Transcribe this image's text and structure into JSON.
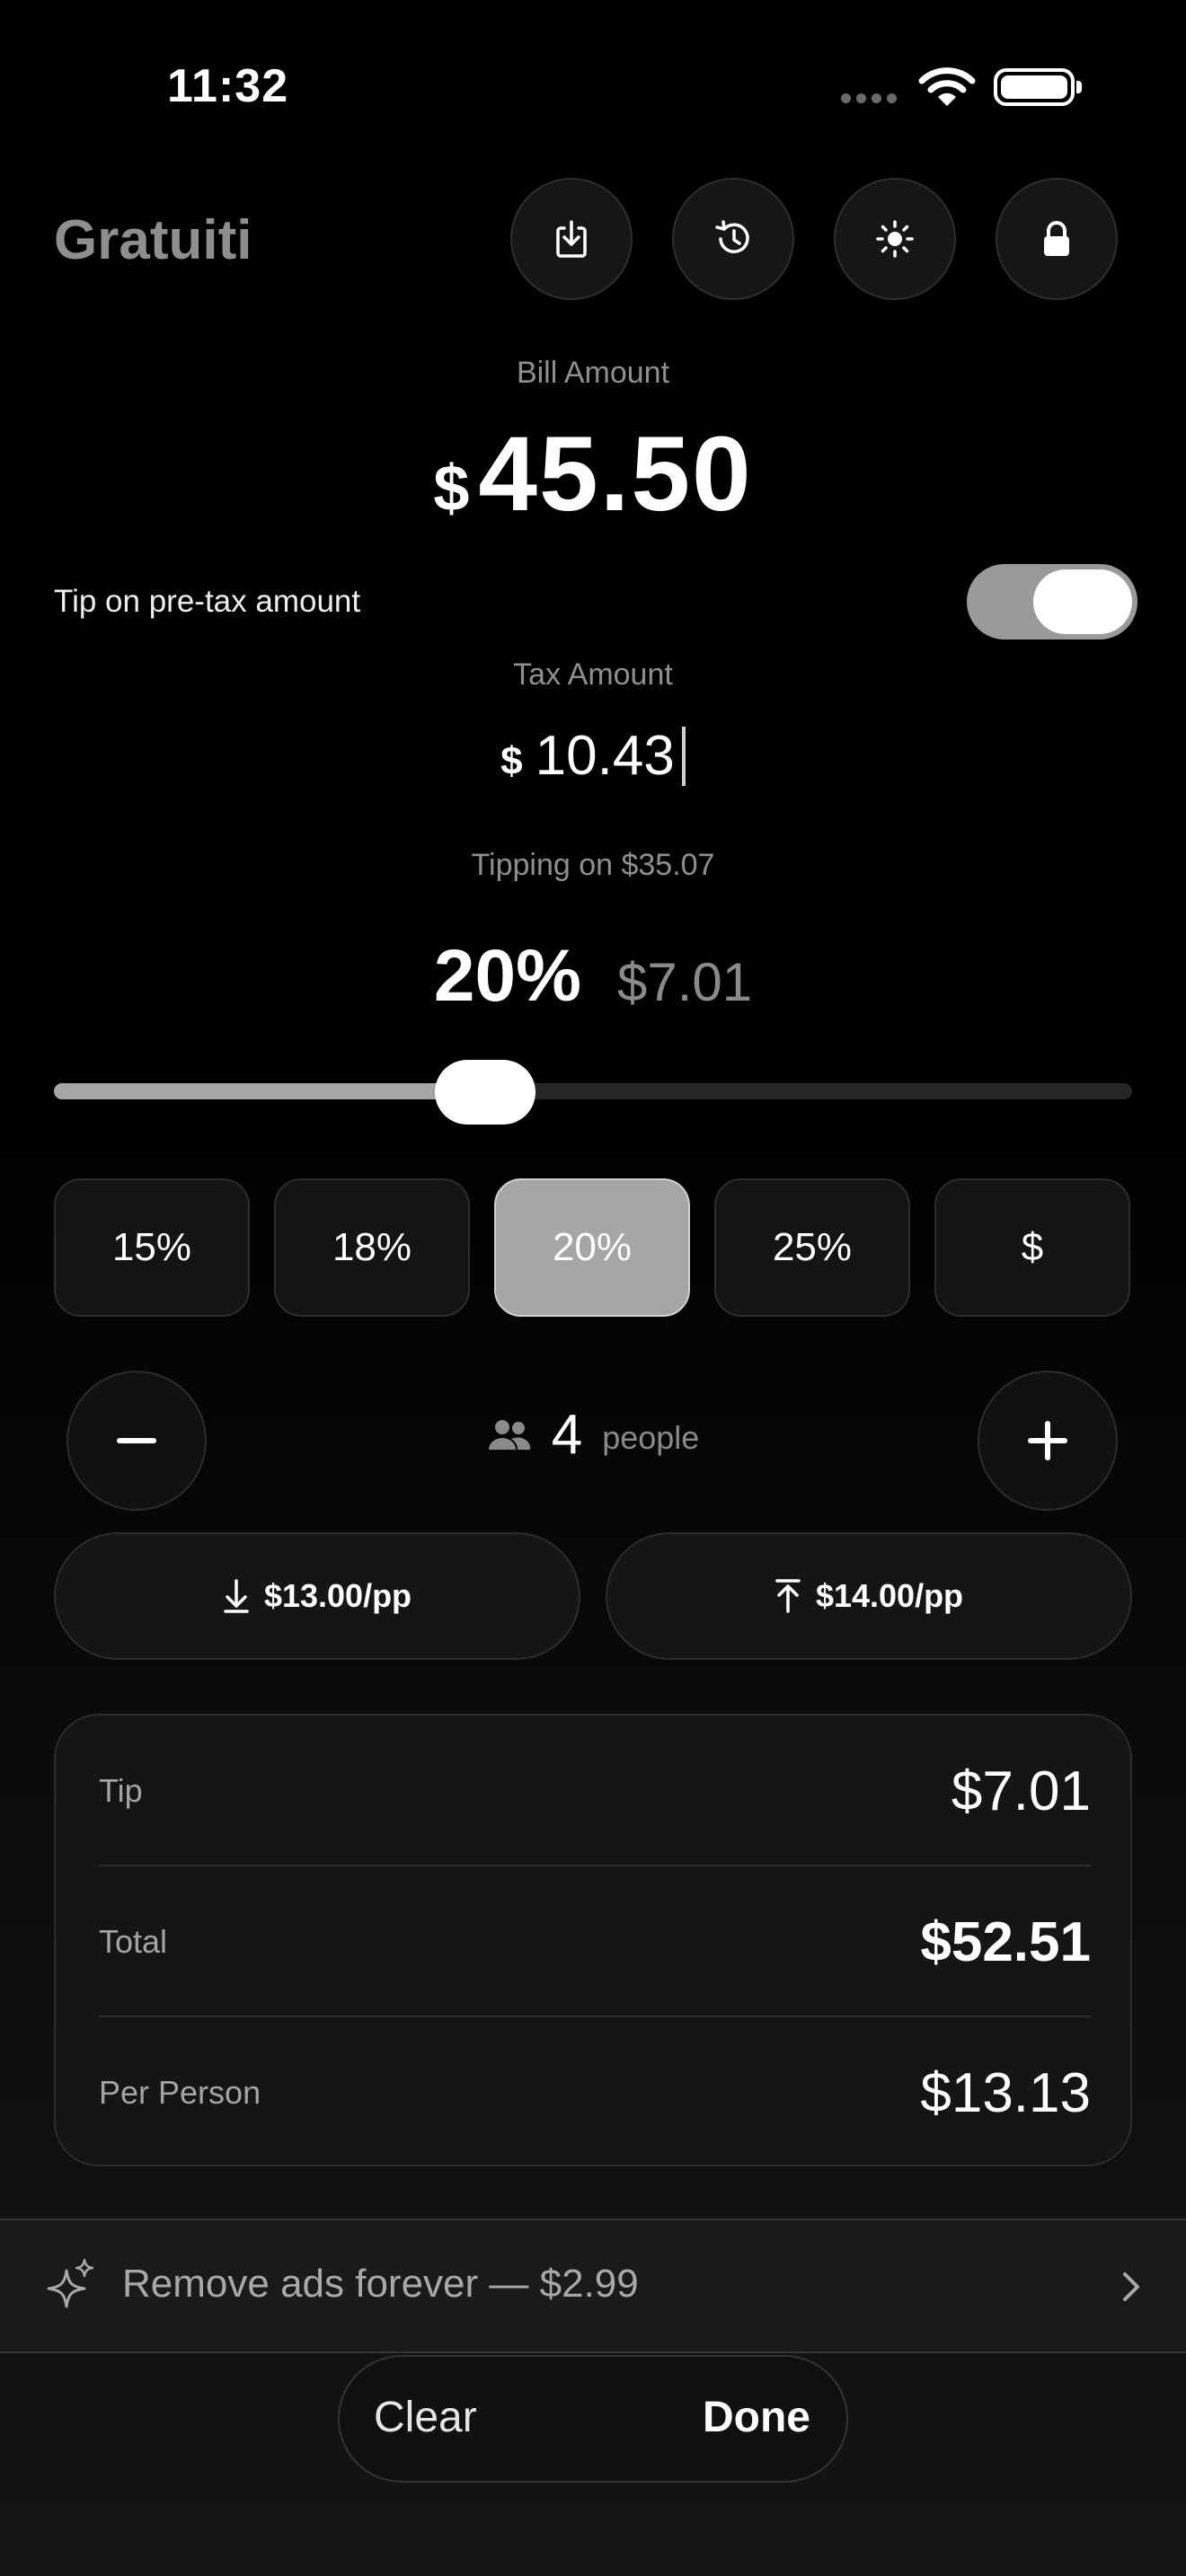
{
  "status_bar": {
    "time": "11:32"
  },
  "app": {
    "title": "Gratuiti"
  },
  "header_buttons": [
    {
      "icon": "save-receipt-icon"
    },
    {
      "icon": "history-icon"
    },
    {
      "icon": "brightness-icon"
    },
    {
      "icon": "lock-icon"
    }
  ],
  "bill": {
    "label": "Bill Amount",
    "currency": "$",
    "value": "45.50"
  },
  "pretax": {
    "label": "Tip on pre-tax amount",
    "enabled": true
  },
  "tax": {
    "label": "Tax Amount",
    "currency": "$",
    "value": "10.43"
  },
  "tipping_on": "Tipping on $35.07",
  "tip": {
    "percent": "20%",
    "amount": "$7.01",
    "slider_fraction": 0.4
  },
  "presets": [
    {
      "label": "15%",
      "active": false
    },
    {
      "label": "18%",
      "active": false
    },
    {
      "label": "20%",
      "active": true
    },
    {
      "label": "25%",
      "active": false
    },
    {
      "label": "$",
      "active": false
    }
  ],
  "people": {
    "count": "4",
    "word": "people"
  },
  "round": {
    "down": "$13.00/pp",
    "up": "$14.00/pp"
  },
  "summary": {
    "tip_label": "Tip",
    "tip_value": "$7.01",
    "total_label": "Total",
    "total_value": "$52.51",
    "per_person_label": "Per Person",
    "per_person_value": "$13.13"
  },
  "banner": {
    "text": "Remove ads forever — $2.99"
  },
  "bottom_bar": {
    "clear": "Clear",
    "done": "Done"
  },
  "colors": {
    "background": "#000000",
    "accent": "#a6a6a6",
    "card": "#151515",
    "muted_text": "#8e8e8e"
  }
}
